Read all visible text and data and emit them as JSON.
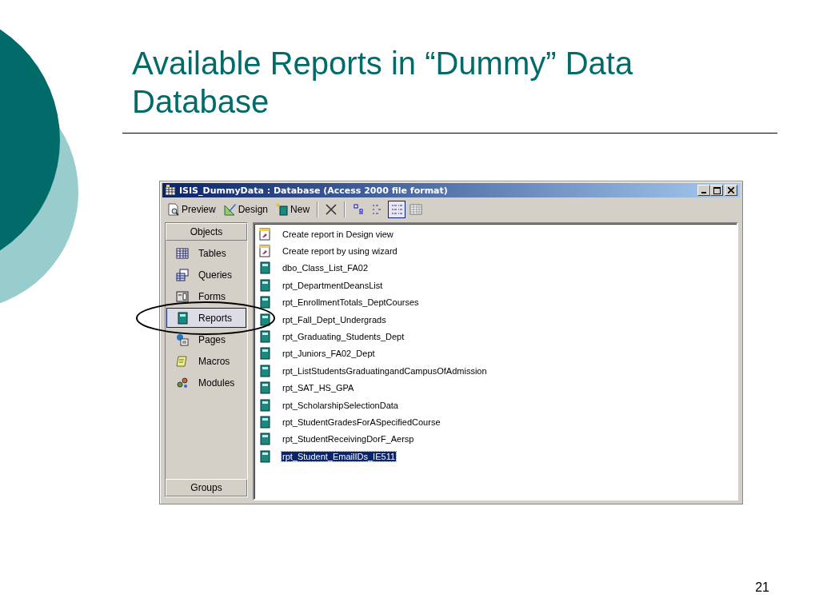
{
  "slide": {
    "title": "Available Reports in “Dummy” Data Database",
    "page_number": "21"
  },
  "window": {
    "title": "ISIS_DummyData : Database (Access 2000 file format)"
  },
  "toolbar": {
    "buttons": [
      {
        "label": "Preview"
      },
      {
        "label": "Design"
      },
      {
        "label": "New"
      }
    ],
    "views": [
      {
        "selected": false
      },
      {
        "selected": false
      },
      {
        "selected": true
      },
      {
        "selected": false
      }
    ]
  },
  "objects": {
    "header": "Objects",
    "footer": "Groups",
    "items": [
      {
        "label": "Tables",
        "selected": false
      },
      {
        "label": "Queries",
        "selected": false
      },
      {
        "label": "Forms",
        "selected": false
      },
      {
        "label": "Reports",
        "selected": true
      },
      {
        "label": "Pages",
        "selected": false
      },
      {
        "label": "Macros",
        "selected": false
      },
      {
        "label": "Modules",
        "selected": false
      }
    ]
  },
  "reports": [
    {
      "kind": "shortcut",
      "name": "Create report in Design view",
      "selected": false
    },
    {
      "kind": "shortcut",
      "name": "Create report by using wizard",
      "selected": false
    },
    {
      "kind": "report",
      "name": "dbo_Class_List_FA02",
      "selected": false
    },
    {
      "kind": "report",
      "name": "rpt_DepartmentDeansList",
      "selected": false
    },
    {
      "kind": "report",
      "name": "rpt_EnrollmentTotals_DeptCourses",
      "selected": false
    },
    {
      "kind": "report",
      "name": "rpt_Fall_Dept_Undergrads",
      "selected": false
    },
    {
      "kind": "report",
      "name": "rpt_Graduating_Students_Dept",
      "selected": false
    },
    {
      "kind": "report",
      "name": "rpt_Juniors_FA02_Dept",
      "selected": false
    },
    {
      "kind": "report",
      "name": "rpt_ListStudentsGraduatingandCampusOfAdmission",
      "selected": false
    },
    {
      "kind": "report",
      "name": "rpt_SAT_HS_GPA",
      "selected": false
    },
    {
      "kind": "report",
      "name": "rpt_ScholarshipSelectionData",
      "selected": false
    },
    {
      "kind": "report",
      "name": "rpt_StudentGradesForASpecifiedCourse",
      "selected": false
    },
    {
      "kind": "report",
      "name": "rpt_StudentReceivingDorF_Aersp",
      "selected": false
    },
    {
      "kind": "report",
      "name": "rpt_Student_EmailIDs_IE511",
      "selected": true
    }
  ]
}
